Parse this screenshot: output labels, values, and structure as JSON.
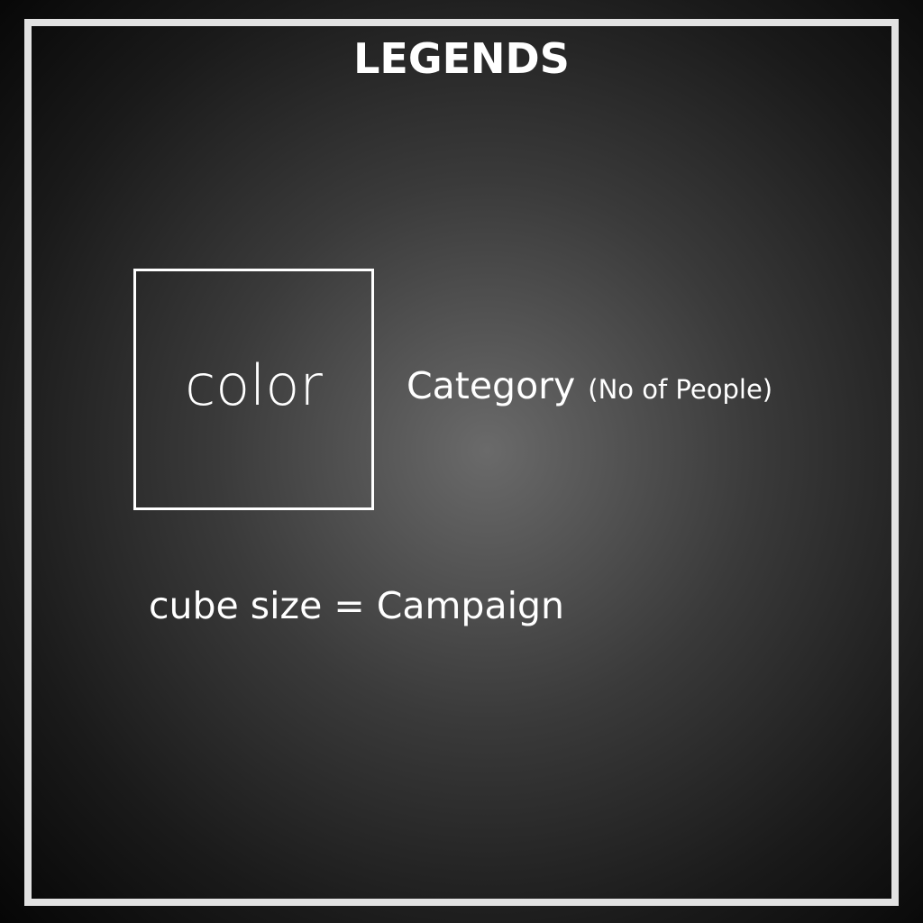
{
  "title": "LEGENDS",
  "legend": {
    "swatch_label": "color",
    "category_label": "Category",
    "category_note": "(No of People)",
    "size_label": "cube size = Campaign"
  },
  "colors": {
    "frame": "#e2e2e2",
    "text": "#ffffff"
  }
}
